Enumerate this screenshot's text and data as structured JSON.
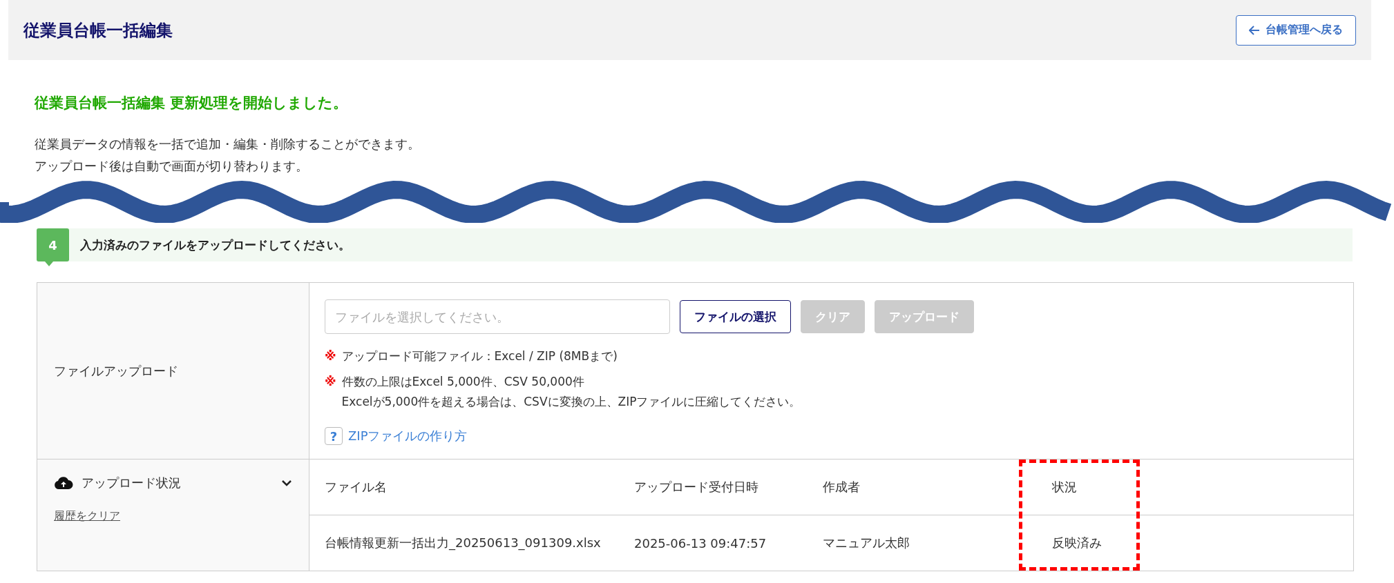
{
  "header": {
    "title": "従業員台帳一括編集",
    "back_button": "台帳管理へ戻る"
  },
  "message": "従業員台帳一括編集 更新処理を開始しました。",
  "description": [
    "従業員データの情報を一括で追加・編集・削除することができます。",
    "アップロード後は自動で画面が切り替わります。"
  ],
  "step": {
    "number": "4",
    "text": "入力済みのファイルをアップロードしてください。"
  },
  "upload": {
    "label": "ファイルアップロード",
    "file_field": {
      "placeholder": "ファイルを選択してください。"
    },
    "buttons": [
      {
        "label": "ファイルの選択",
        "disabled": false
      },
      {
        "label": "クリア",
        "disabled": true
      },
      {
        "label": "アップロード",
        "disabled": true
      }
    ],
    "notes": [
      {
        "mark": "※",
        "lines": [
          "アップロード可能ファイル：Excel / ZIP (8MBまで)"
        ]
      },
      {
        "mark": "※",
        "lines": [
          "件数の上限はExcel 5,000件、CSV 50,000件",
          "Excelが5,000件を超える場合は、CSVに変換の上、ZIPファイルに圧縮してください。"
        ]
      }
    ],
    "help_icon": "?",
    "help_link": "ZIPファイルの作り方"
  },
  "status": {
    "label": "アップロード状況",
    "clear_link": "履歴をクリア",
    "columns": [
      {
        "label": "ファイル名",
        "highlighted": false
      },
      {
        "label": "アップロード受付日時",
        "highlighted": false
      },
      {
        "label": "作成者",
        "highlighted": false
      },
      {
        "label": "状況",
        "highlighted": true
      }
    ],
    "rows": [
      [
        "台帳情報更新一括出力_20250613_091309.xlsx",
        "2025-06-13 09:47:57",
        "マニュアル太郎",
        "反映済み"
      ]
    ]
  }
}
